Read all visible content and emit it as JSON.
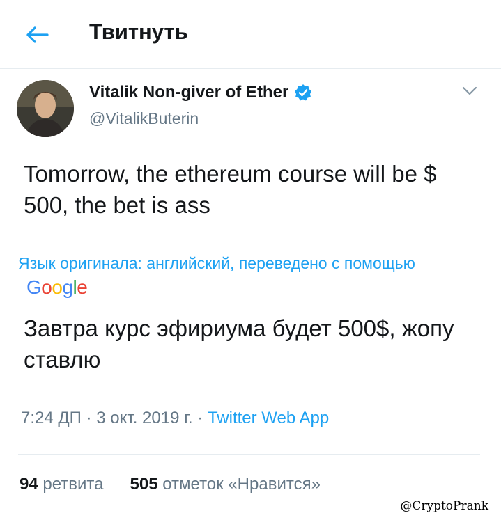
{
  "header": {
    "title": "Твитнуть"
  },
  "tweet": {
    "author_name": "Vitalik Non-giver of Ether",
    "author_handle": "@VitalikButerin",
    "text": "Tomorrow, the ethereum course will be $ 500, the bet is ass",
    "translation_note": "Язык оригинала: английский, переведено с помощью",
    "translation_provider": "Google",
    "translated_text": "Завтра курс эфириума будет 500$, жопу ставлю",
    "time": "7:24 ДП",
    "date": "3 окт. 2019 г.",
    "separator": "·",
    "source": "Twitter Web App",
    "retweets_count": "94",
    "retweets_label": "ретвита",
    "likes_count": "505",
    "likes_label": "отметок «Нравится»"
  },
  "watermark": "@CryptoPrank",
  "colors": {
    "accent": "#1da1f2",
    "text": "#14171a",
    "muted": "#657786",
    "divider": "#e6ecf0"
  },
  "icons": {
    "back": "arrow-left-icon",
    "verified": "verified-badge-icon",
    "more": "chevron-down-icon"
  }
}
